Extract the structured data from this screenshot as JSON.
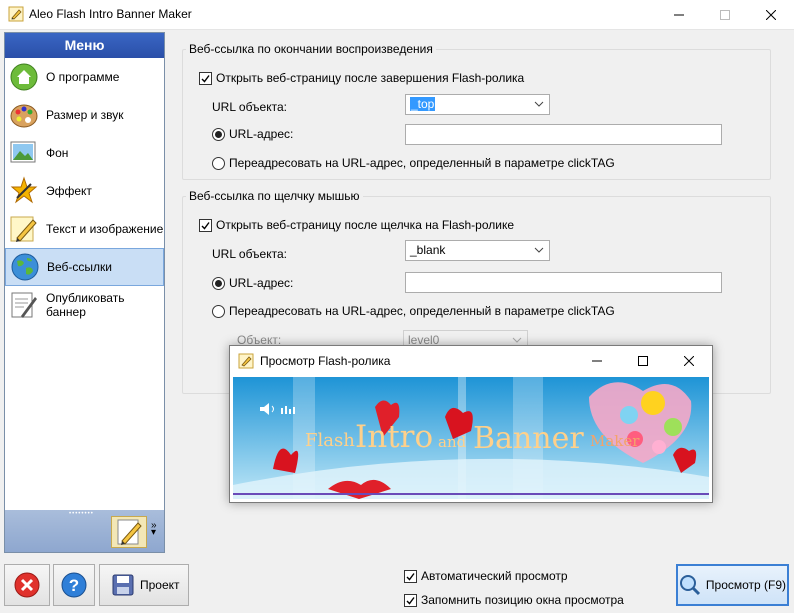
{
  "window": {
    "title": "Aleo Flash Intro Banner Maker"
  },
  "sidebar": {
    "header": "Меню",
    "items": [
      {
        "label": "О программе",
        "icon": "home-icon",
        "active": false
      },
      {
        "label": "Размер и звук",
        "icon": "palette-icon",
        "active": false
      },
      {
        "label": "Фон",
        "icon": "picture-icon",
        "active": false
      },
      {
        "label": "Эффект",
        "icon": "effect-icon",
        "active": false
      },
      {
        "label": "Текст и изображение",
        "icon": "pencil-icon",
        "active": false
      },
      {
        "label": "Веб-ссылки",
        "icon": "globe-icon",
        "active": true
      },
      {
        "label": "Опубликовать баннер",
        "icon": "publish-icon",
        "active": false
      }
    ]
  },
  "group_end": {
    "legend": "Веб-ссылка по окончании воспроизведения",
    "open_checkbox": {
      "label": "Открыть веб-страницу после завершения Flash-ролика",
      "checked": true
    },
    "target_label": "URL объекта:",
    "target_value": "_top",
    "url_radio": {
      "label": "URL-адрес:",
      "selected": true
    },
    "url_value": "",
    "clicktag_radio": {
      "label": "Переадресовать на URL-адрес, определенный в параметре clickTAG",
      "selected": false
    }
  },
  "group_click": {
    "legend": "Веб-ссылка по щелчку мышью",
    "open_checkbox": {
      "label": "Открыть веб-страницу после щелчка на Flash-ролике",
      "checked": true
    },
    "target_label": "URL объекта:",
    "target_value": "_blank",
    "url_radio": {
      "label": "URL-адрес:",
      "selected": true
    },
    "url_value": "",
    "clicktag_radio": {
      "label": "Переадресовать на URL-адрес, определенный в параметре clickTAG",
      "selected": false
    },
    "object_label": "Объект:",
    "object_value": "level0"
  },
  "preview_window": {
    "title": "Просмотр Flash-ролика",
    "banner_words": [
      "Flash",
      "Intro",
      "and",
      "Banner",
      "Maker"
    ]
  },
  "bottom": {
    "project_button": "Проект",
    "auto_preview": {
      "label": "Автоматический просмотр",
      "checked": true
    },
    "remember_position": {
      "label": "Запомнить позицию окна просмотра",
      "checked": true
    },
    "preview_button": "Просмотр (F9)"
  },
  "colors": {
    "menu_header": "#2a4fa8",
    "active_item": "#c9def5",
    "selection": "#3399ff",
    "close_button": "#e0312c",
    "help_button": "#2f7fd8"
  }
}
